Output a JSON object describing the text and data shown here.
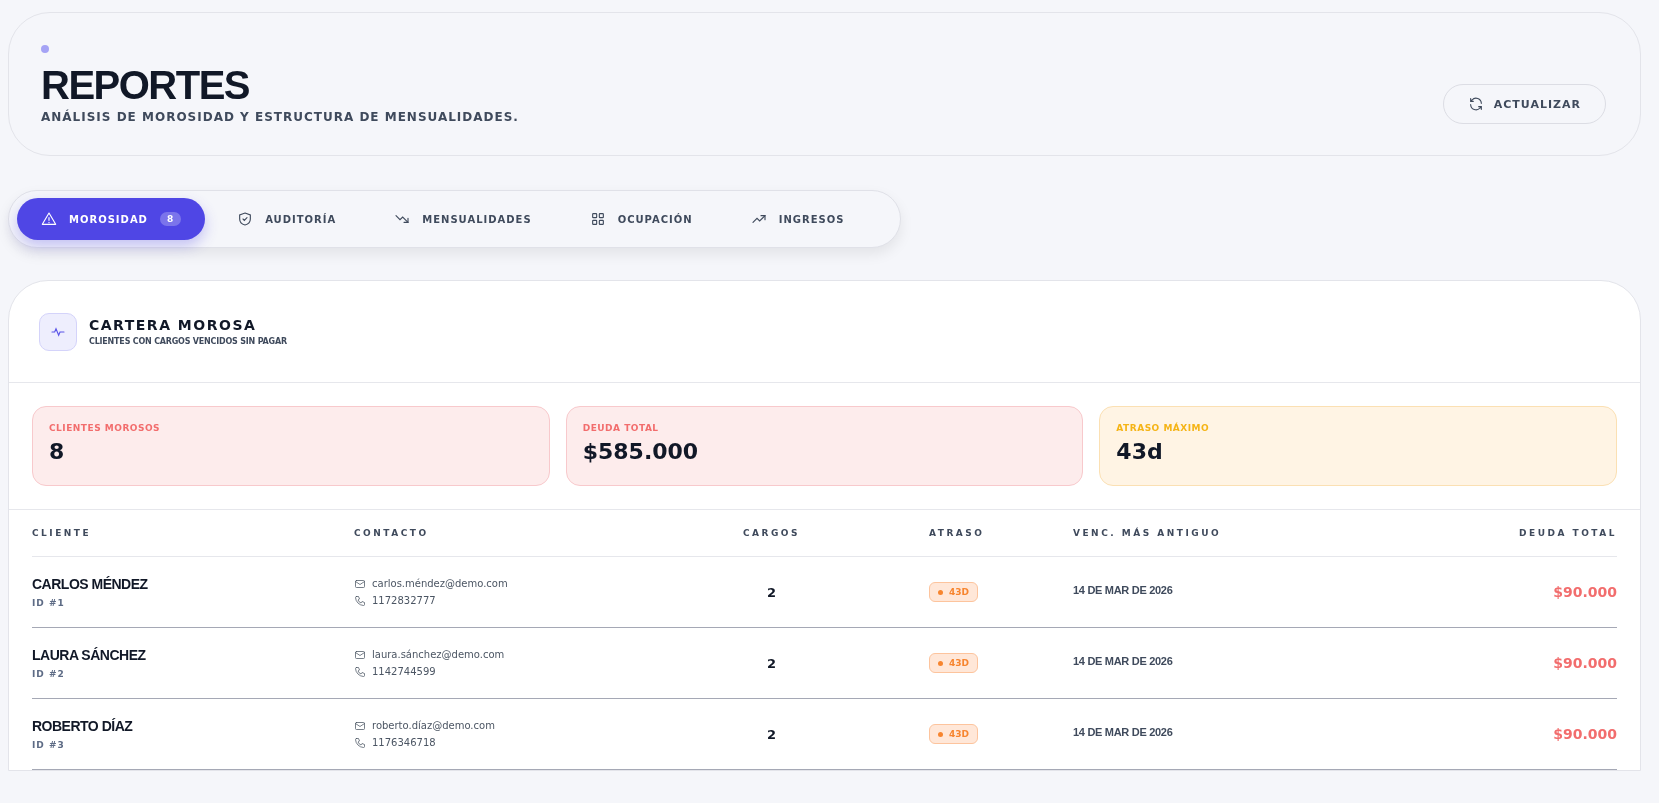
{
  "header": {
    "title": "REPORTES",
    "subtitle": "ANÁLISIS DE MOROSIDAD Y ESTRUCTURA DE MENSUALIDADES.",
    "refresh_button": "ACTUALIZAR"
  },
  "tabs": [
    {
      "label": "MOROSIDAD",
      "kind": "warning",
      "count": "8",
      "selected": true
    },
    {
      "label": "AUDITORÍA",
      "kind": "shield",
      "selected": false
    },
    {
      "label": "MENSUALIDADES",
      "kind": "trend-down",
      "selected": false
    },
    {
      "label": "OCUPACIÓN",
      "kind": "grid",
      "selected": false
    },
    {
      "label": "INGRESOS",
      "kind": "trend-up",
      "selected": false
    }
  ],
  "panel": {
    "title": "CARTERA MOROSA",
    "subtitle": "CLIENTES CON CARGOS VENCIDOS SIN PAGAR",
    "stats": [
      {
        "label": "CLIENTES MOROSOS",
        "value": "8",
        "kind": "red"
      },
      {
        "label": "DEUDA TOTAL",
        "value": "$585.000",
        "kind": "red"
      },
      {
        "label": "ATRASO MÁXIMO",
        "value": "43d",
        "kind": "amber"
      }
    ],
    "table": {
      "columns": [
        "CLIENTE",
        "CONTACTO",
        "CARGOS",
        "ATRASO",
        "VENC. MÁS ANTIGUO",
        "DEUDA TOTAL"
      ],
      "rows": [
        {
          "name": "CARLOS MÉNDEZ",
          "id": "ID #1",
          "email": "carlos.méndez@demo.com",
          "phone": "1172832777",
          "charges": "2",
          "delay": "43D",
          "oldest_due": "14 DE MAR DE 2026",
          "debt": "$90.000"
        },
        {
          "name": "LAURA SÁNCHEZ",
          "id": "ID #2",
          "email": "laura.sánchez@demo.com",
          "phone": "1142744599",
          "charges": "2",
          "delay": "43D",
          "oldest_due": "14 DE MAR DE 2026",
          "debt": "$90.000"
        },
        {
          "name": "ROBERTO DÍAZ",
          "id": "ID #3",
          "email": "roberto.díaz@demo.com",
          "phone": "1176346718",
          "charges": "2",
          "delay": "43D",
          "oldest_due": "14 DE MAR DE 2026",
          "debt": "$90.000"
        }
      ]
    }
  }
}
